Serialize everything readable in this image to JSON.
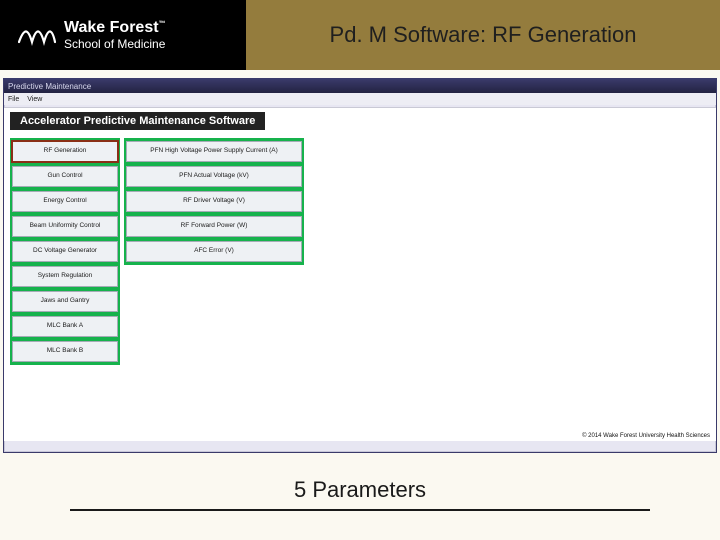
{
  "header": {
    "brand_line1": "Wake Forest",
    "brand_tm": "™",
    "brand_line2": "School of Medicine",
    "slide_title": "Pd. M Software: RF Generation"
  },
  "window": {
    "title": "Predictive Maintenance",
    "menu": {
      "file": "File",
      "view": "View"
    }
  },
  "app": {
    "heading": "Accelerator Predictive Maintenance Software",
    "tabs": [
      "RF Generation",
      "Gun Control",
      "Energy Control",
      "Beam Uniformity Control",
      "DC Voltage Generator",
      "System Regulation",
      "Jaws and Gantry",
      "MLC Bank A",
      "MLC Bank B"
    ],
    "selected_tab_index": 0,
    "params": [
      "PFN High Voltage Power Supply Current (A)",
      "PFN Actual Voltage (kV)",
      "RF Driver Voltage (V)",
      "RF Forward Power (W)",
      "AFC Error (V)"
    ],
    "copyright": "© 2014 Wake Forest University Health Sciences"
  },
  "footer": {
    "caption": "5 Parameters"
  }
}
